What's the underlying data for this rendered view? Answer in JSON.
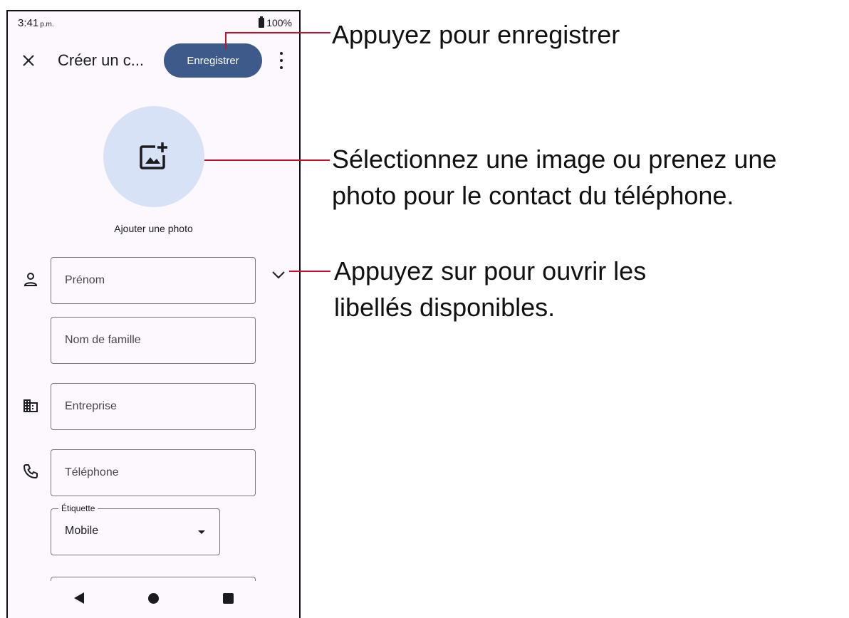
{
  "status_bar": {
    "time": "3:41",
    "ampm": "p.m.",
    "battery": "100%"
  },
  "toolbar": {
    "title": "Créer un c...",
    "save_label": "Enregistrer"
  },
  "photo": {
    "label": "Ajouter une photo"
  },
  "fields": {
    "first_name": "Prénom",
    "last_name": "Nom de famille",
    "company": "Entreprise",
    "phone": "Téléphone"
  },
  "phone_label": {
    "legend": "Étiquette",
    "value": "Mobile"
  },
  "callouts": {
    "save": "Appuyez pour enregistrer",
    "photo_line1": "Sélectionnez une image ou prenez une",
    "photo_line2": "photo pour le contact du téléphone.",
    "labels_line1": "Appuyez sur pour ouvrir les",
    "labels_line2": "libellés disponibles."
  },
  "colors": {
    "accent": "#3d5a8a",
    "callout_line": "#c8102e",
    "avatar_bg": "#d8e2f7"
  },
  "icons": [
    "close-icon",
    "more-vert-icon",
    "add-photo-icon",
    "person-icon",
    "expand-more-icon",
    "business-icon",
    "phone-icon",
    "dropdown-arrow-icon",
    "nav-back-icon",
    "nav-home-icon",
    "nav-recents-icon",
    "battery-icon"
  ]
}
